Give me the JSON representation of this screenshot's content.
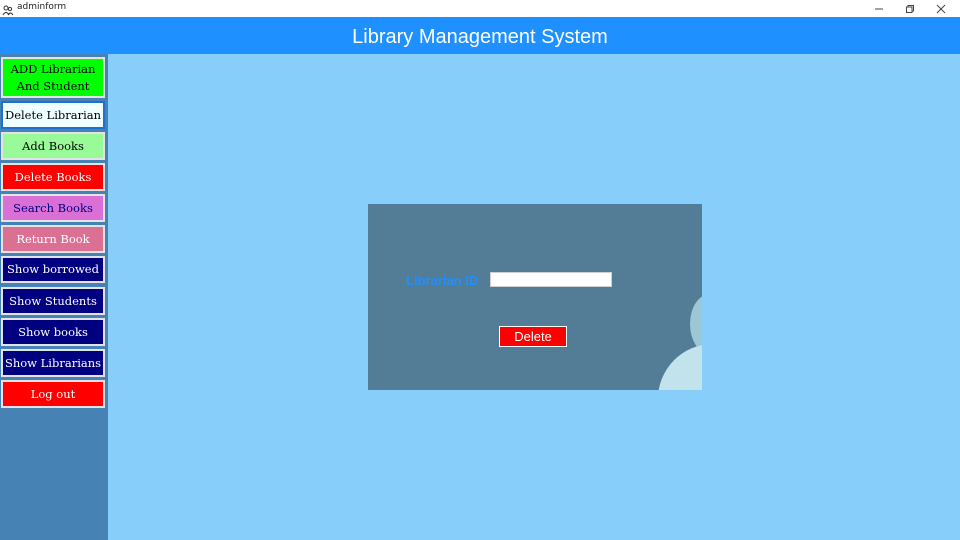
{
  "window": {
    "title": "adminform",
    "icons": {
      "app": "users-icon",
      "minimize": "minimize-icon",
      "maximize": "restore-icon",
      "close": "close-icon"
    }
  },
  "header": {
    "title": "Library Management System"
  },
  "sidebar": {
    "items": [
      {
        "line1": "ADD Librarian",
        "line2": "And Student",
        "bg": "#00ff00",
        "color": "#000000"
      },
      {
        "label": "Delete Librarian",
        "bg": "#f0ffff",
        "color": "#000000"
      },
      {
        "label": "Add Books",
        "bg": "#98fb98",
        "color": "#000000"
      },
      {
        "label": "Delete Books",
        "bg": "#ff0000",
        "color": "#ffffff"
      },
      {
        "label": "Search Books",
        "bg": "#da70d6",
        "color": "#000080"
      },
      {
        "label": "Return Book",
        "bg": "#db7093",
        "color": "#ffffff"
      },
      {
        "label": "Show borrowed",
        "bg": "#000080",
        "color": "#ffffff"
      },
      {
        "label": "Show Students",
        "bg": "#000080",
        "color": "#ffffff"
      },
      {
        "label": "Show books",
        "bg": "#000080",
        "color": "#ffffff"
      },
      {
        "label": "Show Librarians",
        "bg": "#000080",
        "color": "#ffffff"
      },
      {
        "label": "Log out",
        "bg": "#ff0000",
        "color": "#ffffff"
      }
    ]
  },
  "form": {
    "field_label": "Librarian ID",
    "field_value": "",
    "field_placeholder": "",
    "delete_label": "Delete"
  },
  "colors": {
    "header": "#1e90ff",
    "sidebar": "#4682b4",
    "main": "#87cefa",
    "card": "#537d97",
    "delete_button": "#ff0000",
    "label": "#1e90ff"
  }
}
